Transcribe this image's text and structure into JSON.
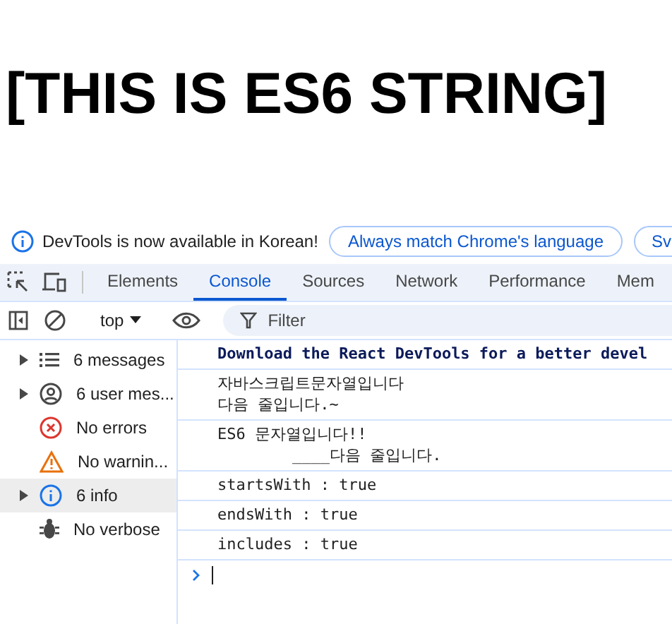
{
  "heading": "[THIS IS ES6 STRING]",
  "banner": {
    "text": "DevTools is now available in Korean!",
    "buttons": [
      "Always match Chrome's language",
      "Sv"
    ]
  },
  "tabs": [
    {
      "label": "Elements",
      "selected": false
    },
    {
      "label": "Console",
      "selected": true
    },
    {
      "label": "Sources",
      "selected": false
    },
    {
      "label": "Network",
      "selected": false
    },
    {
      "label": "Performance",
      "selected": false
    },
    {
      "label": "Mem",
      "selected": false
    }
  ],
  "toolbar": {
    "context": "top",
    "filter_placeholder": "Filter"
  },
  "sidebar": [
    {
      "kind": "messages",
      "label": "6 messages",
      "expandable": true,
      "selected": false
    },
    {
      "kind": "user",
      "label": "6 user mes...",
      "expandable": true,
      "selected": false
    },
    {
      "kind": "errors",
      "label": "No errors",
      "expandable": false,
      "selected": false
    },
    {
      "kind": "warnings",
      "label": "No warnin...",
      "expandable": false,
      "selected": false
    },
    {
      "kind": "info",
      "label": "6 info",
      "expandable": true,
      "selected": true
    },
    {
      "kind": "verbose",
      "label": "No verbose",
      "expandable": false,
      "selected": false
    }
  ],
  "messages": [
    {
      "kind": "bold",
      "text": "Download the React DevTools for a better devel"
    },
    {
      "kind": "plain",
      "text": "자바스크립트문자열입니다\n다음 줄입니다.~"
    },
    {
      "kind": "plain",
      "text": "ES6 문자열입니다!!\n        ____다음 줄입니다."
    },
    {
      "kind": "plain",
      "text": "startsWith : true"
    },
    {
      "kind": "plain",
      "text": "endsWith : true"
    },
    {
      "kind": "plain",
      "text": "includes : true"
    }
  ]
}
